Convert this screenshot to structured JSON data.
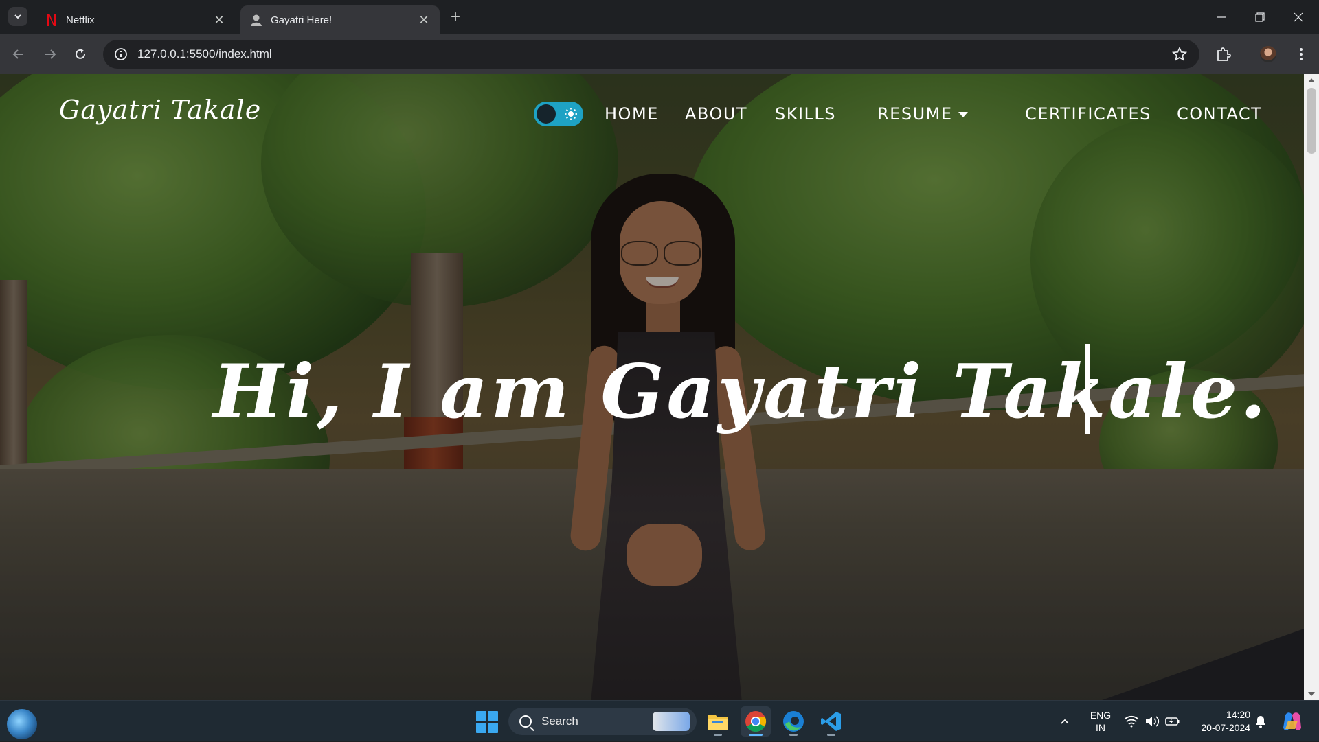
{
  "browser": {
    "tabs": [
      {
        "title": "Netflix",
        "active": false
      },
      {
        "title": "Gayatri Here!",
        "active": true
      }
    ],
    "url": "127.0.0.1:5500/index.html"
  },
  "site": {
    "logo": "Gayatri Takale",
    "nav": [
      "HOME",
      "ABOUT",
      "SKILLS",
      "RESUME",
      "CERTIFICATES",
      "CONTACT"
    ],
    "hero_text": "Hi, I am Gayatri Takale.",
    "theme_toggle": {
      "state": "dark",
      "accent": "#1ea2c4"
    }
  },
  "taskbar": {
    "search_placeholder": "Search",
    "apps": [
      "file-explorer",
      "chrome",
      "edge",
      "vscode"
    ],
    "language_top": "ENG",
    "language_bottom": "IN",
    "time": "14:20",
    "date": "20-07-2024"
  },
  "colors": {
    "tab_bar": "#1e2023",
    "toolbar": "#35363a",
    "taskbar": "#1f2a33",
    "toggle_accent": "#1ea2c4"
  }
}
